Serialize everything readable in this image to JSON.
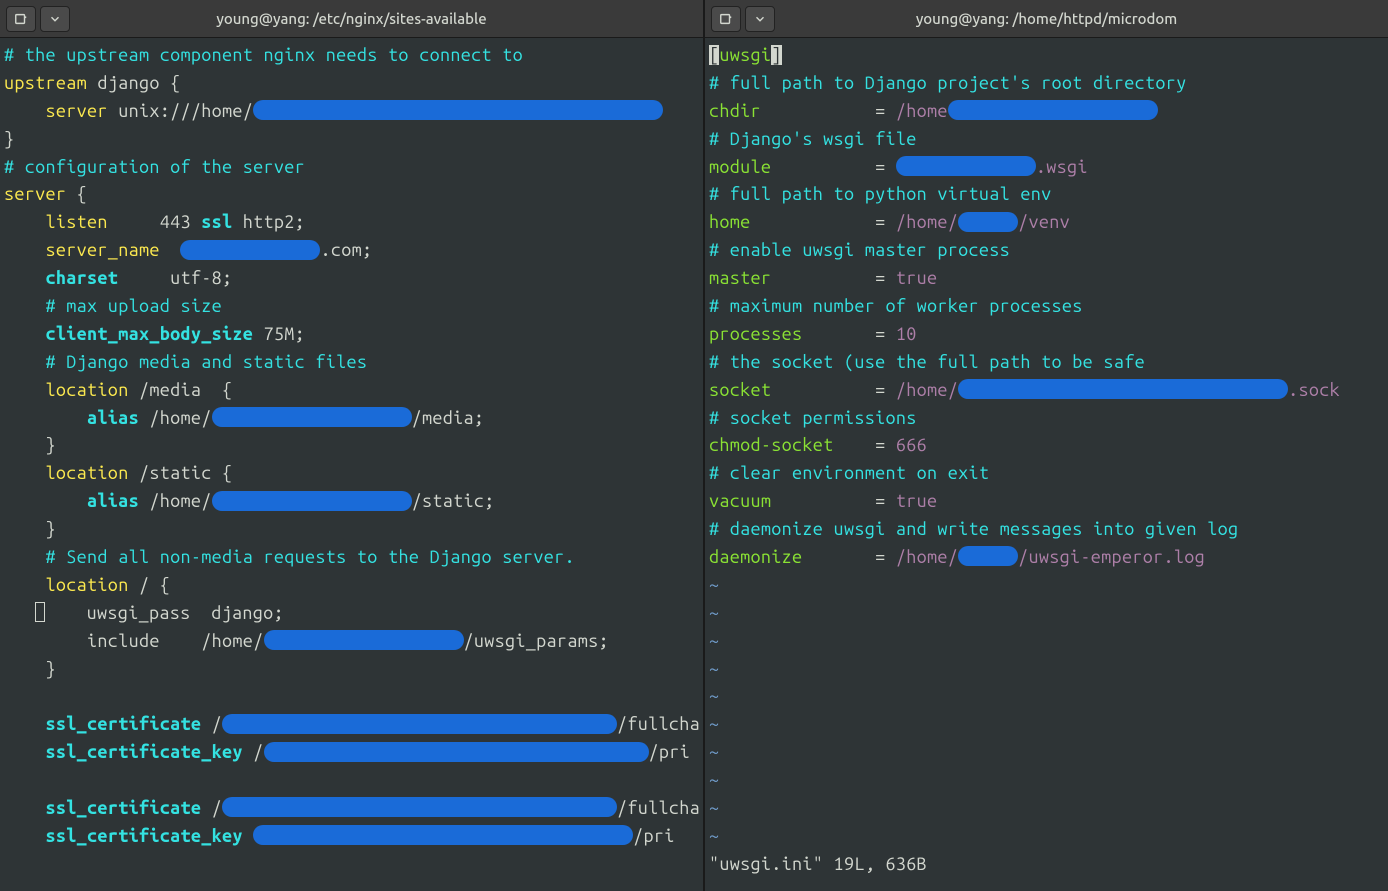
{
  "left": {
    "title": "young@yang: /etc/nginx/sites-available",
    "lines": {
      "c1": "# the upstream component nginx needs to connect to",
      "upstream": "upstream",
      "django_brace": " django {",
      "server_kw": "server",
      "unix": " unix:///home/",
      "close1": "}",
      "c2": "# configuration of the server",
      "server_open": " {",
      "listen_kw": "listen",
      "listen_val1": "     443 ",
      "ssl": "ssl",
      "http2": " http2;",
      "server_name_kw": "server_name",
      "server_name_end": ".com;",
      "charset_kw": "charset",
      "charset_val": "     utf-8;",
      "c3": "# max upload size",
      "cmbs_kw": "client_max_body_size",
      "cmbs_val": " 75M;",
      "c4": "# Django media and static files",
      "location": "location",
      "media": " /media  {",
      "alias": "alias",
      "home_pre": " /home/",
      "media_end": "/media;",
      "static": " /static {",
      "static_end": "/static;",
      "c5": "# Send all non-media requests to the Django server.",
      "root": " / {",
      "uwsgi_pass": "uwsgi_pass  django;",
      "include": "include    /home/",
      "include_end": "/uwsgi_params;",
      "ssl_cert": "ssl_certificate",
      "fullcha": "/fullcha",
      "ssl_cert_key": "ssl_certificate_key",
      "pri": "/pri"
    }
  },
  "right": {
    "title": "young@yang: /home/httpd/microdom",
    "section": "uwsgi",
    "c1": "# full path to Django project's root directory",
    "chdir": "chdir",
    "eq": "= ",
    "home_path": "/home",
    "c2": "# Django's wsgi file",
    "module": "module",
    "wsgi": ".wsgi",
    "c3": "# full path to python virtual env",
    "home_kw": "home",
    "venv": "venv",
    "c4": "# enable uwsgi master process",
    "master": "master",
    "true": "true",
    "c5": "# maximum number of worker processes",
    "processes": "processes",
    "ten": "10",
    "c6": "# the socket (use the full path to be safe",
    "socket": "socket",
    "sock": ".sock",
    "c7": "# socket permissions",
    "chmod": "chmod-socket",
    "sixsixsix": "666",
    "c8": "# clear environment on exit",
    "vacuum": "vacuum",
    "c9": "# daemonize uwsgi and write messages into given log",
    "daemonize": "daemonize",
    "logpath": "/uwsgi-emperor.log",
    "tilde": "~",
    "status": "\"uwsgi.ini\" 19L, 636B"
  }
}
